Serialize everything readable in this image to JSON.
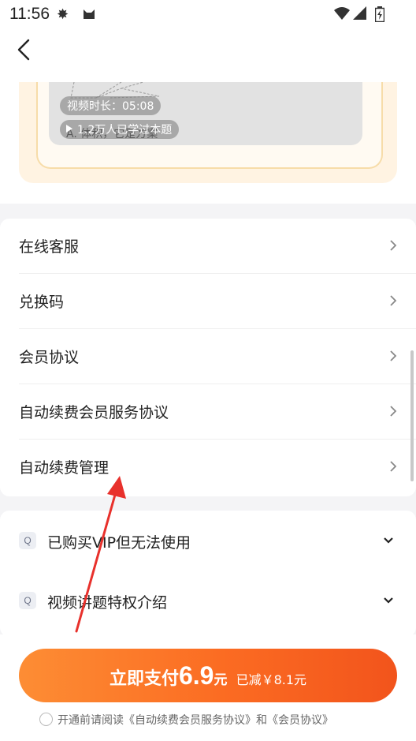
{
  "status_bar": {
    "time": "11:56",
    "left_icons": [
      "burst-icon",
      "cat-icon"
    ],
    "right_icons": [
      "wifi-icon",
      "signal-icon",
      "battery-icon"
    ]
  },
  "nav": {
    "back_icon": "back-chevron-icon"
  },
  "video_card": {
    "duration": "视频时长：05:08",
    "learners": "1.2万人已学过本题",
    "question_fragment": "A. 体积，它是方案"
  },
  "menu": {
    "items": [
      {
        "label": "在线客服"
      },
      {
        "label": "兑换码"
      },
      {
        "label": "会员协议"
      },
      {
        "label": "自动续费会员服务协议"
      },
      {
        "label": "自动续费管理"
      }
    ]
  },
  "faq": {
    "badge": "Q",
    "items": [
      {
        "label": "已购买VIP但无法使用"
      },
      {
        "label": "视频讲题特权介绍"
      }
    ]
  },
  "pay": {
    "label": "立即支付",
    "price": "6.9",
    "unit": "元",
    "discount": "已减￥8.1元"
  },
  "agreement": {
    "text": "开通前请阅读《自动续费会员服务协议》和《会员协议》"
  },
  "colors": {
    "accent": "#fb6b22",
    "annotation_arrow": "#e8312c"
  }
}
